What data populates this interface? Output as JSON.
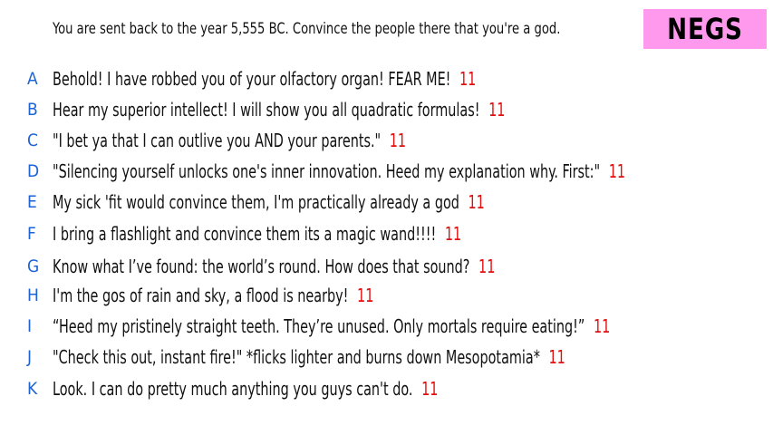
{
  "prompt": "You are sent back to the year 5,555 BC. Convince the people there that you're a god.",
  "badge": "NEGS",
  "colors": {
    "letter": "#1e63d6",
    "score": "#e01010",
    "badge_bg": "#ff99ee"
  },
  "entries": [
    {
      "letter": "A",
      "text": "Behold! I have robbed you of your olfactory organ! FEAR ME!",
      "score": "11"
    },
    {
      "letter": "B",
      "text": "Hear my superior intellect! I will show you all quadratic formulas!",
      "score": "11"
    },
    {
      "letter": "C",
      "text": "\"I bet ya that I can outlive you AND your parents.\"",
      "score": "11"
    },
    {
      "letter": "D",
      "text": "\"Silencing yourself unlocks one's inner innovation. Heed my explanation why. First:\"",
      "score": "11"
    },
    {
      "letter": "E",
      "text": "My sick 'fit would convince them, I'm practically already a god",
      "score": "11"
    },
    {
      "letter": "F",
      "text": "I bring a flashlight and convince them its a magic wand!!!!",
      "score": "11"
    },
    {
      "letter": "G",
      "text": "Know what I’ve found: the world’s round. How does that sound?",
      "score": "11"
    },
    {
      "letter": "H",
      "text": "I'm the gos of rain and sky, a flood is nearby!",
      "score": "11"
    },
    {
      "letter": "I",
      "text": "“Heed my pristinely straight teeth. They’re unused. Only mortals require eating!”",
      "score": "11"
    },
    {
      "letter": "J",
      "text": "\"Check this out, instant fire!\" *flicks lighter and burns down Mesopotamia*",
      "score": "11"
    },
    {
      "letter": "K",
      "text": "Look. I can do pretty much anything you guys can't do.",
      "score": "11"
    }
  ]
}
